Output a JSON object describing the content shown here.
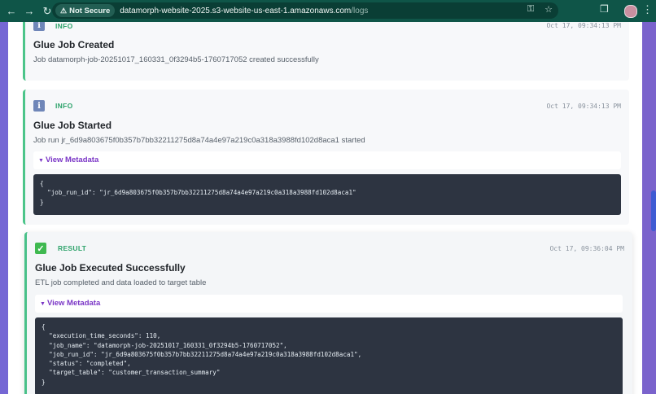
{
  "browser": {
    "back_icon": "arrow-left-icon",
    "forward_icon": "arrow-right-icon",
    "reload_icon": "reload-icon",
    "security_label": "Not Secure",
    "url_host": "datamorph-website-2025.s3-website-us-east-1.amazonaws.com",
    "url_path": "/logs"
  },
  "logs": [
    {
      "level": "INFO",
      "title": "Glue Job Created",
      "message": "Job datamorph-job-20251017_160331_0f3294b5-1760717052 created successfully",
      "time": "Oct 17, 09:34:13 PM"
    },
    {
      "level": "INFO",
      "title": "Glue Job Started",
      "message": "Job run jr_6d9a803675f0b357b7bb32211275d8a74a4e97a219c0a318a3988fd102d8aca1 started",
      "time": "Oct 17, 09:34:13 PM",
      "metadata_label": "View Metadata",
      "metadata_json": "{\n  \"job_run_id\": \"jr_6d9a803675f0b357b7bb32211275d8a74a4e97a219c0a318a3988fd102d8aca1\"\n}"
    },
    {
      "level": "RESULT",
      "title": "Glue Job Executed Successfully",
      "message": "ETL job completed and data loaded to target table",
      "time": "Oct 17, 09:36:04 PM",
      "metadata_label": "View Metadata",
      "metadata_json": "{\n  \"execution_time_seconds\": 110,\n  \"job_name\": \"datamorph-job-20251017_160331_0f3294b5-1760717052\",\n  \"job_run_id\": \"jr_6d9a803675f0b357b7bb32211275d8a74a4e97a219c0a318a3988fd102d8aca1\",\n  \"status\": \"completed\",\n  \"target_table\": \"customer_transaction_summary\"\n}"
    }
  ],
  "colors": {
    "accent_green": "#4cc58a",
    "metadata_link": "#7a35c6",
    "code_bg": "#2d3441",
    "chrome_bg": "#0f5548"
  }
}
